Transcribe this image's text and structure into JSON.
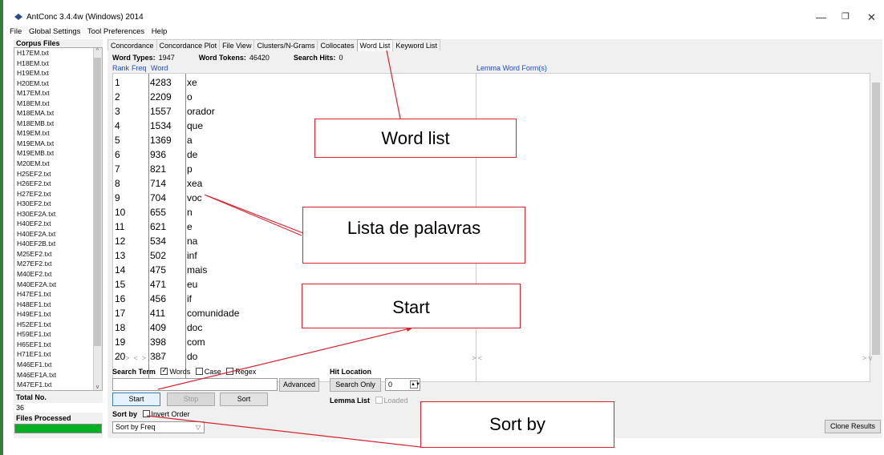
{
  "window": {
    "title": "AntConc 3.4.4w (Windows) 2014",
    "minimize": "—",
    "maximize": "❐",
    "close": "✕"
  },
  "menu": [
    "File",
    "Global Settings",
    "Tool Preferences",
    "Help"
  ],
  "left_panel": {
    "header": "Corpus Files",
    "files": [
      "H17EM.txt",
      "H18EM.txt",
      "H19EM.txt",
      "H20EM.txt",
      "M17EM.txt",
      "M18EM.txt",
      "M18EMA.txt",
      "M18EMB.txt",
      "M19EM.txt",
      "M19EMA.txt",
      "M19EMB.txt",
      "M20EM.txt",
      "H25EF2.txt",
      "H26EF2.txt",
      "H27EF2.txt",
      "H30EF2.txt",
      "H30EF2A.txt",
      "H40EF2.txt",
      "H40EF2A.txt",
      "H40EF2B.txt",
      "M25EF2.txt",
      "M27EF2.txt",
      "M40EF2.txt",
      "M40EF2A.txt",
      "H47EF1.txt",
      "H48EF1.txt",
      "H49EF1.txt",
      "H52EF1.txt",
      "H59EF1.txt",
      "H65EF1.txt",
      "H71EF1.txt",
      "M46EF1.txt",
      "M46EF1A.txt",
      "M47EF1.txt"
    ],
    "total_label": "Total No.",
    "total_value": "36",
    "files_processed_label": "Files Processed",
    "progress": 1.0
  },
  "tabs": [
    "Concordance",
    "Concordance Plot",
    "File View",
    "Clusters/N-Grams",
    "Collocates",
    "Word List",
    "Keyword List"
  ],
  "active_tab": "Word List",
  "stats": {
    "types_label": "Word Types:",
    "types_value": "1947",
    "tokens_label": "Word Tokens:",
    "tokens_value": "46420",
    "hits_label": "Search Hits:",
    "hits_value": "0"
  },
  "columns": {
    "rank": "Rank",
    "freq": "Freq",
    "word": "Word",
    "lemma": "Lemma Word Form(s)"
  },
  "rows": [
    {
      "rank": "1",
      "freq": "4283",
      "word": "xe"
    },
    {
      "rank": "2",
      "freq": "2209",
      "word": "o"
    },
    {
      "rank": "3",
      "freq": "1557",
      "word": "orador"
    },
    {
      "rank": "4",
      "freq": "1534",
      "word": "que"
    },
    {
      "rank": "5",
      "freq": "1369",
      "word": "a"
    },
    {
      "rank": "6",
      "freq": "936",
      "word": "de"
    },
    {
      "rank": "7",
      "freq": "821",
      "word": "p"
    },
    {
      "rank": "8",
      "freq": "714",
      "word": "xea"
    },
    {
      "rank": "9",
      "freq": "704",
      "word": "voc"
    },
    {
      "rank": "10",
      "freq": "655",
      "word": "n"
    },
    {
      "rank": "11",
      "freq": "621",
      "word": "e"
    },
    {
      "rank": "12",
      "freq": "534",
      "word": "na"
    },
    {
      "rank": "13",
      "freq": "502",
      "word": "inf"
    },
    {
      "rank": "14",
      "freq": "475",
      "word": "mais"
    },
    {
      "rank": "15",
      "freq": "471",
      "word": "eu"
    },
    {
      "rank": "16",
      "freq": "456",
      "word": "if"
    },
    {
      "rank": "17",
      "freq": "411",
      "word": "comunidade"
    },
    {
      "rank": "18",
      "freq": "409",
      "word": "doc"
    },
    {
      "rank": "19",
      "freq": "398",
      "word": "com"
    },
    {
      "rank": "20",
      "freq": "387",
      "word": "do"
    }
  ],
  "search": {
    "label": "Search Term",
    "words": "Words",
    "words_checked": true,
    "case": "Case",
    "case_checked": false,
    "regex": "Regex",
    "regex_checked": false,
    "value": "",
    "advanced": "Advanced"
  },
  "hit_location": {
    "label": "Hit Location",
    "search_only": "Search Only",
    "value": "0"
  },
  "lemma_list": {
    "label": "Lemma List",
    "loaded": "Loaded"
  },
  "buttons": {
    "start": "Start",
    "stop": "Stop",
    "sort": "Sort",
    "clone": "Clone Results"
  },
  "sort": {
    "label": "Sort by",
    "invert": "Invert Order",
    "selected": "Sort by Freq"
  },
  "annotations": {
    "word_list": "Word list",
    "lista": "Lista de palavras",
    "start": "Start",
    "sort_by": "Sort by",
    "color": "#d9232d"
  }
}
